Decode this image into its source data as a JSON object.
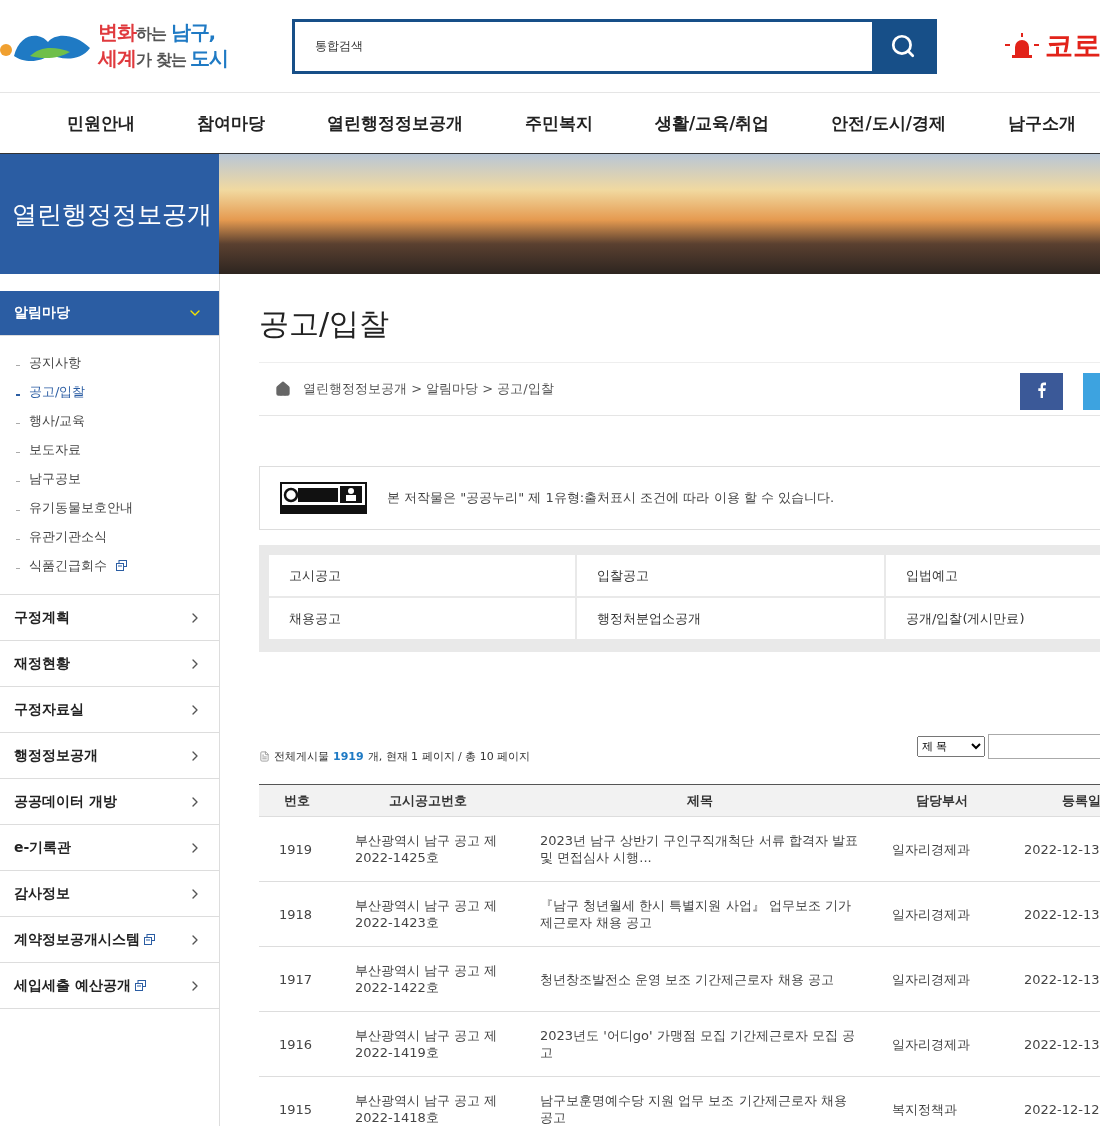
{
  "header": {
    "logo_line1": [
      {
        "text": "변화",
        "color": "#e03a3e"
      },
      {
        "text": "하는 ",
        "color": "#555555"
      },
      {
        "text": "남구,",
        "color": "#1f7ac4"
      }
    ],
    "logo_line2": [
      {
        "text": "세계",
        "color": "#e03a3e"
      },
      {
        "text": "가 찾는 ",
        "color": "#555555"
      },
      {
        "text": "도시",
        "color": "#1f7ac4"
      }
    ],
    "search": {
      "placeholder": "통합검색"
    },
    "alert_label": "코로"
  },
  "nav": [
    {
      "label": "민원안내"
    },
    {
      "label": "참여마당"
    },
    {
      "label": "열린행정정보공개"
    },
    {
      "label": "주민복지"
    },
    {
      "label": "생활/교육/취업"
    },
    {
      "label": "안전/도시/경제"
    },
    {
      "label": "남구소개"
    }
  ],
  "banner": {
    "title": "열린행정정보공개"
  },
  "sidebar": [
    {
      "label": "알림마당",
      "expanded": true,
      "external": false,
      "children": [
        {
          "label": "공지사항",
          "selected": false,
          "external": false
        },
        {
          "label": "공고/입찰",
          "selected": true,
          "external": false
        },
        {
          "label": "행사/교육",
          "selected": false,
          "external": false
        },
        {
          "label": "보도자료",
          "selected": false,
          "external": false
        },
        {
          "label": "남구공보",
          "selected": false,
          "external": false
        },
        {
          "label": "유기동물보호안내",
          "selected": false,
          "external": false
        },
        {
          "label": "유관기관소식",
          "selected": false,
          "external": false
        },
        {
          "label": "식품긴급회수",
          "selected": false,
          "external": true
        }
      ]
    },
    {
      "label": "구정계획",
      "expanded": false,
      "external": false
    },
    {
      "label": "재정현황",
      "expanded": false,
      "external": false
    },
    {
      "label": "구정자료실",
      "expanded": false,
      "external": false
    },
    {
      "label": "행정정보공개",
      "expanded": false,
      "external": false
    },
    {
      "label": "공공데이터 개방",
      "expanded": false,
      "external": false
    },
    {
      "label": "e-기록관",
      "expanded": false,
      "external": false
    },
    {
      "label": "감사정보",
      "expanded": false,
      "external": false
    },
    {
      "label": "계약정보공개시스템",
      "expanded": false,
      "external": true
    },
    {
      "label": "세입세출 예산공개",
      "expanded": false,
      "external": true
    }
  ],
  "page_title": "공고/입찰",
  "breadcrumb": "열린행정정보공개 > 알림마당 > 공고/입찰",
  "license_text": "본 저작물은 \"공공누리\" 제 1유형:출처표시 조건에 따라 이용 할 수 있습니다.",
  "categories": [
    {
      "label": "고시공고",
      "selected": false
    },
    {
      "label": "입찰공고",
      "selected": false
    },
    {
      "label": "입법예고",
      "selected": false
    },
    {
      "label": "채용공고",
      "selected": false
    },
    {
      "label": "행정처분업소공개",
      "selected": false
    },
    {
      "label": "공개/입찰(게시만료)",
      "selected": false
    }
  ],
  "summary": {
    "prefix": "전체게시물",
    "count": "1919",
    "suffix": "개, 현재 1 페이지 / 총 10 페이지"
  },
  "search_filter": {
    "value": "제 목"
  },
  "table": {
    "columns": [
      "번호",
      "고시공고번호",
      "제목",
      "담당부서",
      "등록일"
    ],
    "rows": [
      [
        "1919",
        "부산광역시 남구 공고 제2022-1425호",
        "2023년 남구 상반기 구인구직개척단 서류 합격자 발표 및 면접심사 시행...",
        "일자리경제과",
        "2022-12-13"
      ],
      [
        "1918",
        "부산광역시 남구 공고 제2022-1423호",
        "『남구 청년월세 한시 특별지원 사업』 업무보조 기가제근로자 채용 공고",
        "일자리경제과",
        "2022-12-13"
      ],
      [
        "1917",
        "부산광역시 남구 공고 제2022-1422호",
        "청년창조발전소 운영 보조 기간제근로자 채용 공고",
        "일자리경제과",
        "2022-12-13"
      ],
      [
        "1916",
        "부산광역시 남구 공고 제2022-1419호",
        "2023년도 '어디go' 가맹점 모집 기간제근로자 모집 공고",
        "일자리경제과",
        "2022-12-13"
      ],
      [
        "1915",
        "부산광역시 남구 공고 제2022-1418호",
        "남구보훈명예수당 지원 업무 보조 기간제근로자 채용 공고",
        "복지정책과",
        "2022-12-12"
      ]
    ]
  }
}
